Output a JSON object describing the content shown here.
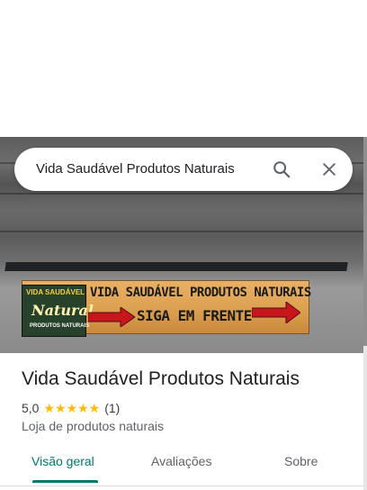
{
  "search": {
    "query": "Vida Saudável Produtos Naturais"
  },
  "photo": {
    "sign_logo_top": "VIDA SAUDÁVEL",
    "sign_logo_brand": "Natural",
    "sign_logo_bottom": "PRODUTOS NATURAIS",
    "sign_line1": "VIDA SAUDÁVEL PRODUTOS NATURAIS",
    "sign_line2": "SIGA EM FRENTE"
  },
  "place": {
    "title": "Vida Saudável Produtos Naturais",
    "rating": "5,0",
    "stars": "★★★★★",
    "review_count": "(1)",
    "category": "Loja de produtos naturais"
  },
  "tabs": [
    {
      "label": "Visão geral",
      "active": true
    },
    {
      "label": "Avaliações",
      "active": false
    },
    {
      "label": "Sobre",
      "active": false
    }
  ],
  "colors": {
    "accent": "#00796b",
    "star": "#fbbc04",
    "sign_wood": "#dca050",
    "arrow_red": "#c8161d"
  },
  "icons": {
    "search": "search-icon",
    "close": "close-icon"
  }
}
